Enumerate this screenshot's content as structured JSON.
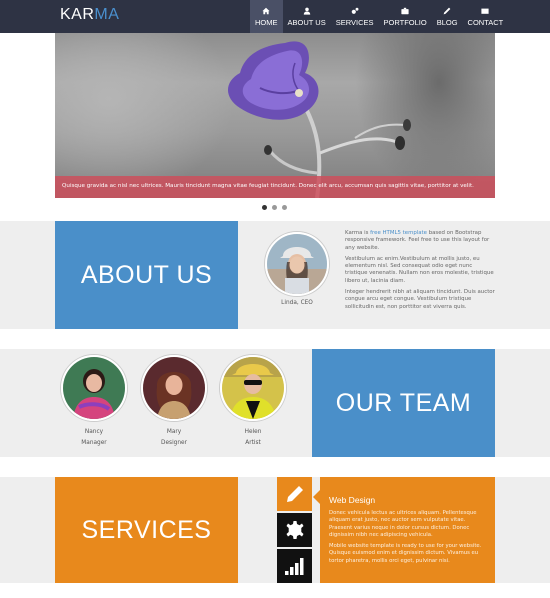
{
  "nav": {
    "logo_part1": "KAR",
    "logo_part2": "MA",
    "items": [
      {
        "label": "HOME",
        "icon": "home-icon",
        "active": true
      },
      {
        "label": "ABOUT US",
        "icon": "user-icon",
        "active": false
      },
      {
        "label": "SERVICES",
        "icon": "cogs-icon",
        "active": false
      },
      {
        "label": "PORTFOLIO",
        "icon": "briefcase-icon",
        "active": false
      },
      {
        "label": "BLOG",
        "icon": "pencil-icon",
        "active": false
      },
      {
        "label": "CONTACT",
        "icon": "envelope-icon",
        "active": false
      }
    ]
  },
  "slider": {
    "caption": "Quisque gravida ac nisl nec ultrices. Mauris tincidunt magna vitae feugiat tincidunt. Donec elit arcu, accumsan quis sagittis vitae, porttitor at velit.",
    "dots": 3,
    "active_dot": 0
  },
  "about": {
    "title": "ABOUT US",
    "person_name": "Linda, CEO",
    "para1_prefix": "Karma is ",
    "para1_link": "free HTML5 template",
    "para1_suffix": " based on Bootstrap responsive framework. Feel free to use this layout for any website.",
    "para2": "Vestibulum ac enim.Vestibulum at mollis justo, eu elementum nisl. Sed consequat odio eget nunc tristique venenatis. Nullam non eros molestie, tristique libero ut, lacinia diam.",
    "para3": "Integer hendrerit nibh at aliquam tincidunt. Duis auctor congue arcu eget congue. Vestibulum tristique sollicitudin est, non porttitor est viverra quis."
  },
  "team": {
    "title": "OUR TEAM",
    "members": [
      {
        "name": "Nancy",
        "role": "Manager"
      },
      {
        "name": "Mary",
        "role": "Designer"
      },
      {
        "name": "Helen",
        "role": "Artist"
      }
    ]
  },
  "services": {
    "title": "SERVICES",
    "icons": [
      "pencil-icon",
      "gear-icon",
      "signal-icon"
    ],
    "panel_title": "Web Design",
    "panel_p1": "Donec vehicula lectus ac ultrices aliquam. Pellentesque aliquam erat justo, nec auctor sem vulputate vitae. Praesent varius neque in dolor cursus dictum. Donec dignissim nibh nec adipiscing vehicula.",
    "panel_p2": "Mobile website template is ready to use for your website. Quisque euismod enim et dignissim dictum. Vivamus eu tortor pharetra, mollis orci eget, pulvinar nisi."
  },
  "colors": {
    "nav_bg": "#2e3344",
    "accent_blue": "#4a8fc9",
    "accent_orange": "#e8891c",
    "caption_red": "#cc4f5c",
    "band_gray": "#eeeeee"
  }
}
